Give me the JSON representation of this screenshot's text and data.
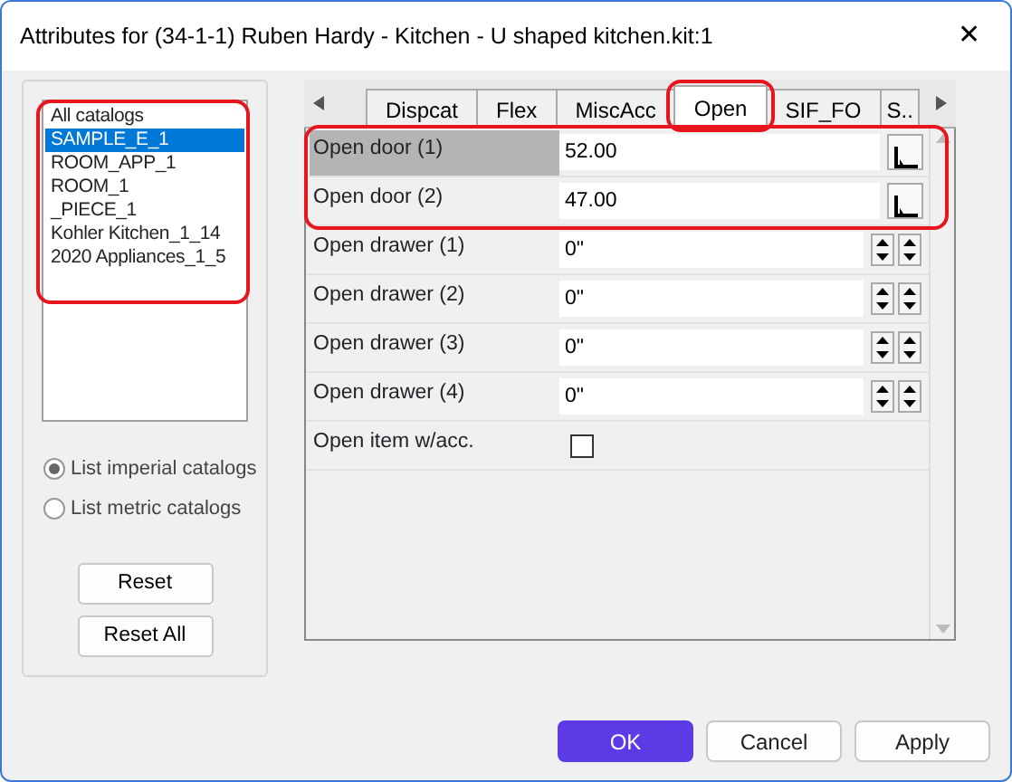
{
  "window": {
    "title": "Attributes for (34-1-1) Ruben Hardy - Kitchen - U shaped kitchen.kit:1",
    "close": "✕"
  },
  "catalogs": [
    {
      "label": "All catalogs",
      "selected": false
    },
    {
      "label": "SAMPLE_E_1",
      "selected": true
    },
    {
      "label": "ROOM_APP_1",
      "selected": false
    },
    {
      "label": "ROOM_1",
      "selected": false
    },
    {
      "label": "_PIECE_1",
      "selected": false
    },
    {
      "label": "Kohler Kitchen_1_14",
      "selected": false
    },
    {
      "label": "2020 Appliances_1_5",
      "selected": false
    }
  ],
  "units": [
    {
      "label": "List imperial catalogs",
      "selected": true
    },
    {
      "label": "List metric catalogs",
      "selected": false
    }
  ],
  "side_buttons": [
    "Reset",
    "Reset All"
  ],
  "tabs": [
    {
      "label": "Dispcat",
      "selected": false
    },
    {
      "label": "Flex",
      "selected": false
    },
    {
      "label": "MiscAcc",
      "selected": false
    },
    {
      "label": "Open",
      "selected": true
    },
    {
      "label": "SIF_FO",
      "selected": false
    },
    {
      "label": "S..",
      "selected": false
    }
  ],
  "attributes": [
    {
      "kind": "measure",
      "label": "Open door (1)",
      "value": "52.00",
      "selected": true
    },
    {
      "kind": "measure",
      "label": "Open door (2)",
      "value": "47.00",
      "selected": false
    },
    {
      "kind": "spin",
      "label": "Open drawer (1)",
      "value": "0\"",
      "selected": false
    },
    {
      "kind": "spin",
      "label": "Open drawer (2)",
      "value": "0\"",
      "selected": false
    },
    {
      "kind": "spin",
      "label": "Open drawer (3)",
      "value": "0\"",
      "selected": false
    },
    {
      "kind": "spin",
      "label": "Open drawer (4)",
      "value": "0\"",
      "selected": false
    },
    {
      "kind": "checkbox",
      "label": "Open item w/acc.",
      "checked": false,
      "selected": false
    }
  ],
  "buttons": [
    {
      "label": "OK",
      "primary": true
    },
    {
      "label": "Cancel",
      "primary": false
    },
    {
      "label": "Apply",
      "primary": false
    }
  ]
}
